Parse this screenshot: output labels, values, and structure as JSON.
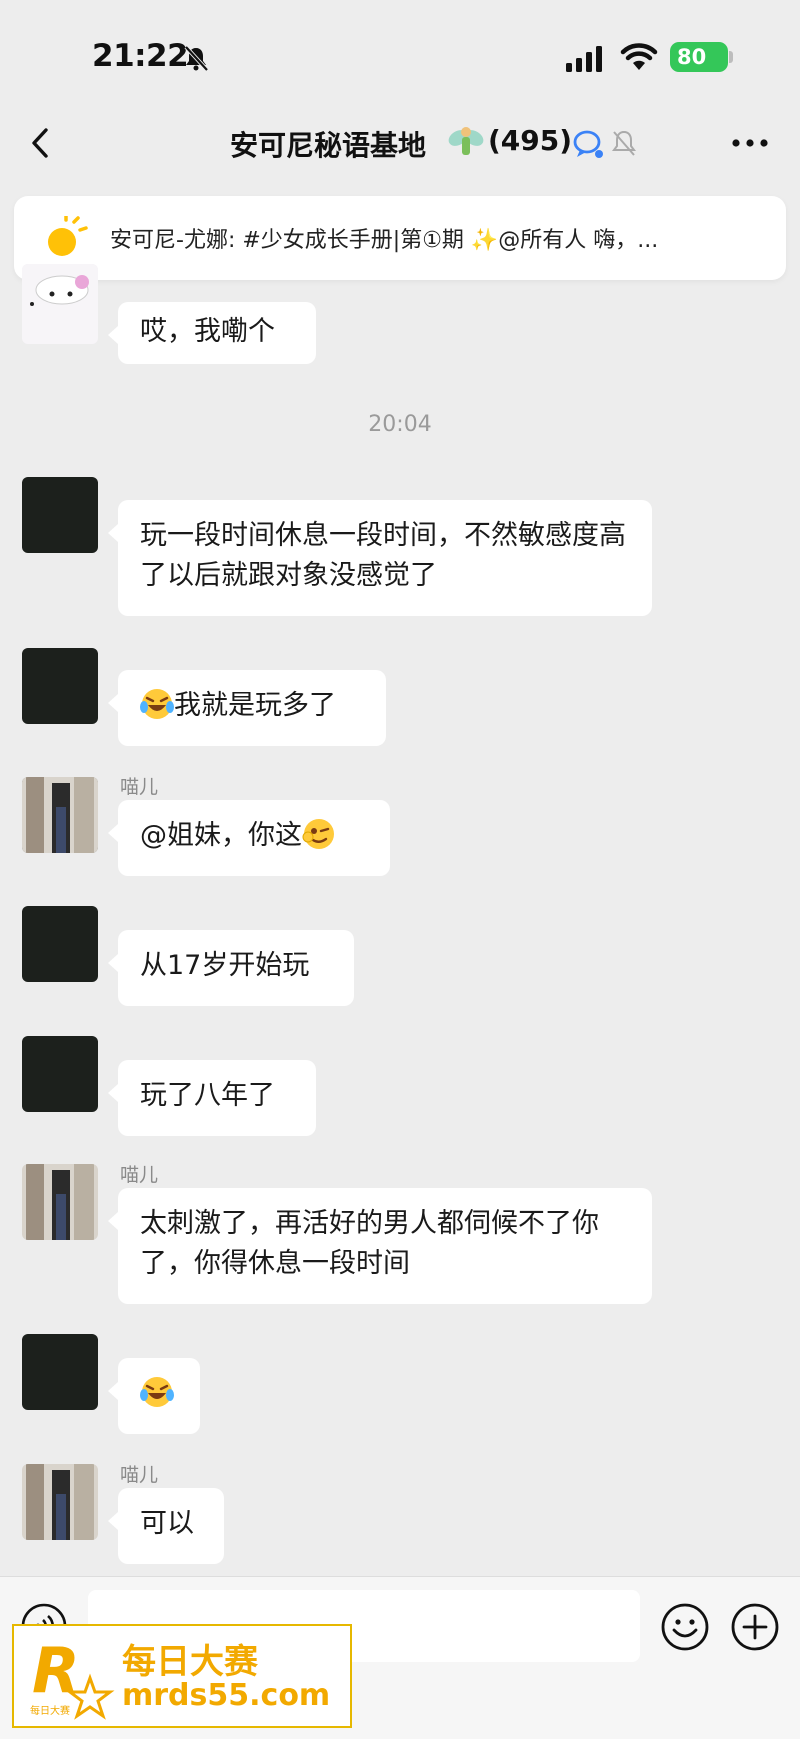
{
  "status_bar": {
    "time": "21:22",
    "battery": "80"
  },
  "header": {
    "title": "安可尼秘语基地",
    "member_count": "(495)"
  },
  "announcement": {
    "text": "安可尼-尤娜: #少女成长手册|第①期 ✨@所有人  嗨，..."
  },
  "timestamp": "20:04",
  "messages": [
    {
      "text": "哎，我嘞个"
    },
    {
      "text": "玩一段时间休息一段时间，不然敏感度高了以后就跟对象没感觉了"
    },
    {
      "text": "我就是玩多了",
      "emoji": "laugh-cry"
    },
    {
      "sender": "喵儿",
      "text": "@姐妹，你这",
      "emoji": "wink"
    },
    {
      "text": "从17岁开始玩"
    },
    {
      "text": "玩了八年了"
    },
    {
      "sender": "喵儿",
      "text": "太刺激了，再活好的男人都伺候不了你了，你得休息一段时间"
    },
    {
      "text": "",
      "emoji": "laugh-cry"
    },
    {
      "sender": "喵儿",
      "text": "可以"
    }
  ],
  "watermark": {
    "line1": "每日大赛",
    "line2": "mrds55.com",
    "logo_text": "每日大赛"
  },
  "colors": {
    "background": "#ededed",
    "bubble": "#ffffff",
    "battery": "#34c759",
    "watermark": "#f2a900"
  }
}
